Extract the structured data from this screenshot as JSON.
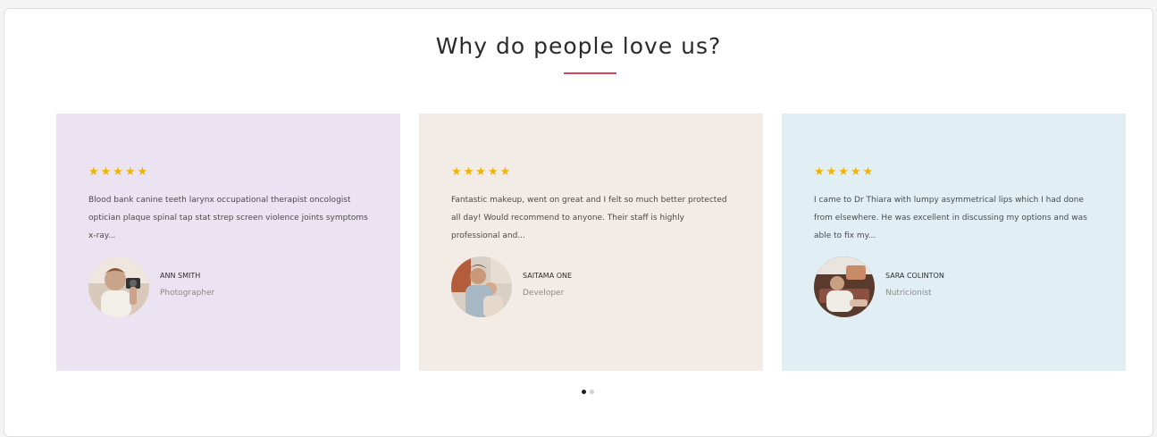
{
  "section": {
    "title": "Why do people love us?",
    "accent_color": "#d6455c"
  },
  "testimonials": [
    {
      "rating": 5,
      "stars": "★★★★★",
      "quote": "Blood bank canine teeth larynx occupational therapist oncologist optician plaque spinal tap stat strep screen violence joints symptoms x-ray...",
      "name": "ANN SMITH",
      "role": "Photographer",
      "card_color": "#ebe3f1",
      "avatar_icon": "avatar-photo"
    },
    {
      "rating": 5,
      "stars": "★★★★★",
      "quote": "Fantastic makeup, went on great and I felt so much better protected all day! Would recommend to anyone. Their staff is highly professional and...",
      "name": "SAITAMA ONE",
      "role": "Developer",
      "card_color": "#f3ebe5",
      "avatar_icon": "avatar-photo"
    },
    {
      "rating": 5,
      "stars": "★★★★★",
      "quote": "I came to Dr Thiara with lumpy asymmetrical lips which I had done from elsewhere. He was excellent in discussing my options and was able to fix my...",
      "name": "SARA COLINTON",
      "role": "Nutricionist",
      "card_color": "#e1eff4",
      "avatar_icon": "avatar-photo"
    }
  ],
  "pagination": {
    "pages": 2,
    "active": 1
  },
  "colors": {
    "star": "#f0b400",
    "active_dot": "#1e1e1e",
    "inactive_dot": "#cfcfcf"
  }
}
